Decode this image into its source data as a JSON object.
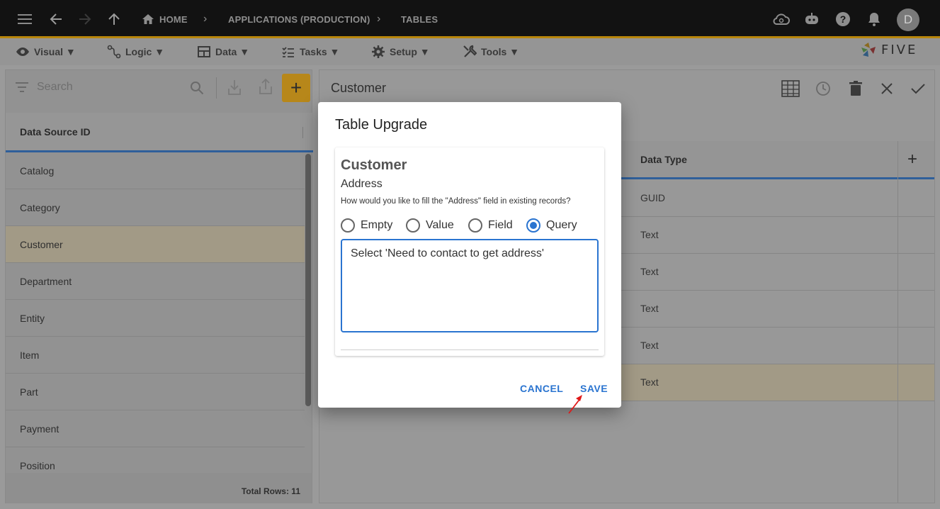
{
  "topbar": {
    "breadcrumbs": [
      "HOME",
      "APPLICATIONS (PRODUCTION)",
      "TABLES"
    ],
    "avatar_letter": "D",
    "icons": [
      "menu-icon",
      "back-icon",
      "forward-icon",
      "up-icon",
      "home-icon",
      "cloud-sync-icon",
      "chat-bot-icon",
      "help-icon",
      "bell-icon"
    ]
  },
  "menubar": {
    "items": [
      {
        "label": "Visual ▼",
        "icon": "eye-icon"
      },
      {
        "label": "Logic ▼",
        "icon": "flow-icon"
      },
      {
        "label": "Data ▼",
        "icon": "table-icon"
      },
      {
        "label": "Tasks ▼",
        "icon": "checklist-icon"
      },
      {
        "label": "Setup ▼",
        "icon": "gear-icon"
      },
      {
        "label": "Tools ▼",
        "icon": "wrench-icon"
      }
    ],
    "brand": "FIVE"
  },
  "left_panel": {
    "search_placeholder": "Search",
    "column_header": "Data Source ID",
    "items": [
      "Catalog",
      "Category",
      "Customer",
      "Department",
      "Entity",
      "Item",
      "Part",
      "Payment",
      "Position"
    ],
    "selected_item": "Customer",
    "footer": "Total Rows: 11"
  },
  "right_panel": {
    "title": "Customer",
    "column_header": "Data Type",
    "rows": [
      "GUID",
      "Text",
      "Text",
      "Text",
      "Text",
      "Text"
    ],
    "selected_row": 5
  },
  "dialog": {
    "title": "Table Upgrade",
    "card_title": "Customer",
    "field_name": "Address",
    "question": "How would you like to fill the \"Address\" field in existing records?",
    "options": [
      "Empty",
      "Value",
      "Field",
      "Query"
    ],
    "selected_option": "Query",
    "query_value": "Select 'Need to contact to get address'",
    "cancel_label": "CANCEL",
    "save_label": "SAVE"
  },
  "colors": {
    "accent": "#2a74d0",
    "add_button": "#b7871a",
    "topbar": "#121212"
  }
}
